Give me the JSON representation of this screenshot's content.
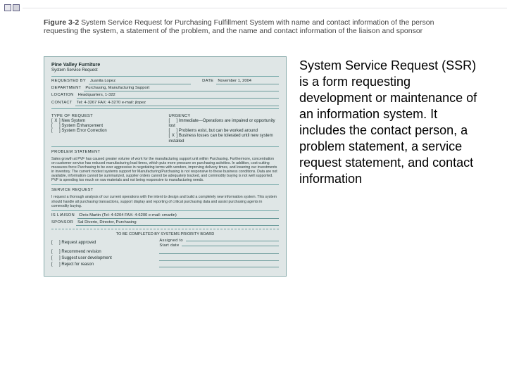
{
  "caption": {
    "figure_label": "Figure 3-2",
    "text": "System Service Request for Purchasing Fulfillment System with name and contact information of the person requesting the system, a statement of the problem, and the name and contact information of the liaison and sponsor"
  },
  "sidetext": "System Service Request (SSR) is a form requesting development or maintenance of an information system. It includes the contact person, a problem statement, a service request statement, and contact information",
  "form": {
    "company": "Pine Valley Furniture",
    "title": "System Service Request",
    "requested_by_label": "REQUESTED BY",
    "requested_by": "Juanita Lopez",
    "date_label": "DATE",
    "date": "November 1, 2004",
    "department_label": "DEPARTMENT",
    "department": "Purchasing, Manufacturing Support",
    "location_label": "LOCATION",
    "location": "Headquarters, 1-322",
    "contact_label": "CONTACT",
    "contact": "Tel: 4-3267   FAX: 4-3270   e-mail: jlopez",
    "type_label": "TYPE OF REQUEST",
    "urgency_label": "URGENCY",
    "types": [
      {
        "mark": "X",
        "text": "New System"
      },
      {
        "mark": " ",
        "text": "System Enhancement"
      },
      {
        "mark": " ",
        "text": "System Error Correction"
      }
    ],
    "urgencies": [
      {
        "mark": " ",
        "text": "Immediate—Operations are impaired or opportunity lost"
      },
      {
        "mark": " ",
        "text": "Problems exist, but can be worked around"
      },
      {
        "mark": "X",
        "text": "Business losses can be tolerated until new system installed"
      }
    ],
    "problem_label": "PROBLEM STATEMENT",
    "problem_text": "Sales growth at PVF has caused greater volume of work for the manufacturing support unit within Purchasing. Furthermore, concentration on customer service has reduced manufacturing lead times, which puts more pressure on purchasing activities. In addition, cost-cutting measures force Purchasing to be ever aggressive in negotiating terms with vendors, improving delivery times, and lowering our investments in inventory. The current modest systems support for Manufacturing/Purchasing is not responsive to these business conditions. Data are not available, information cannot be summarized, supplier orders cannot be adequately tracked, and commodity buying is not well supported. PVF is spending too much on raw materials and not being responsive to manufacturing needs.",
    "service_label": "SERVICE REQUEST",
    "service_text": "I request a thorough analysis of our current operations with the intent to design and build a completely new information system. This system should handle all purchasing transactions, support display and reporting of critical purchasing data and assist purchasing agents in commodity buying.",
    "liaison_label": "IS LIAISON",
    "liaison": "Chris Martin  (Tel: 4-6204  FAX: 4-6200  e-mail: cmartin)",
    "sponsor_label": "SPONSOR",
    "sponsor": "Sal Diverio, Director, Purchasing",
    "board_title": "TO BE COMPLETED BY SYSTEMS PRIORITY BOARD",
    "board_items": [
      "Request approved",
      "Recommend revision",
      "Suggest user development",
      "Reject for reason"
    ],
    "assigned_to_label": "Assigned to",
    "start_date_label": "Start date"
  }
}
